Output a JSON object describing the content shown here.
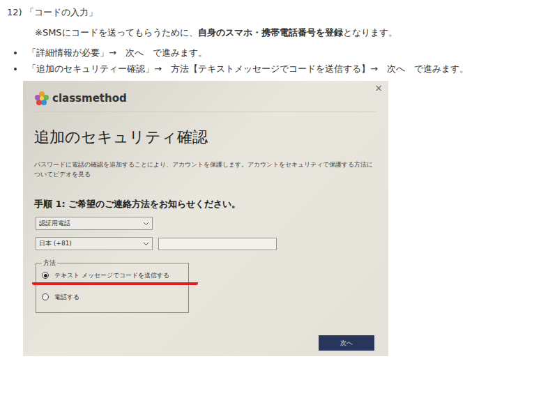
{
  "step": {
    "number": "12)",
    "title": "「コードの入力」"
  },
  "note": {
    "prefix": "※SMSにコードを送ってもらうために、",
    "bold": "自身のスマホ・携帯電話番号を登録",
    "suffix": "となります。"
  },
  "bullets": [
    {
      "text": "「詳細情報が必要」→　次へ　で進みます。"
    },
    {
      "text": "「追加のセキュリティー確認」→　方法【テキストメッセージでコードを送信する】→　次へ　で進みます。"
    }
  ],
  "dialog": {
    "close": "×",
    "logo": "classmethod",
    "title": "追加のセキュリティ確認",
    "description": "パスワードに電話の確認を追加することにより、アカウントを保護します。アカウントをセキュリティで保護する方法についてビデオを見る",
    "step_heading": "手順 1: ご希望のご連絡方法をお知らせください。",
    "contact_select": "認証用電話",
    "country_select": "日本 (+81)",
    "phone_input": "",
    "method_legend": "方法",
    "methods": [
      {
        "label": "テキスト メッセージでコードを送信する",
        "selected": true,
        "underlined": true
      },
      {
        "label": "電話する",
        "selected": false,
        "underlined": false
      }
    ],
    "next_button": "次へ"
  }
}
